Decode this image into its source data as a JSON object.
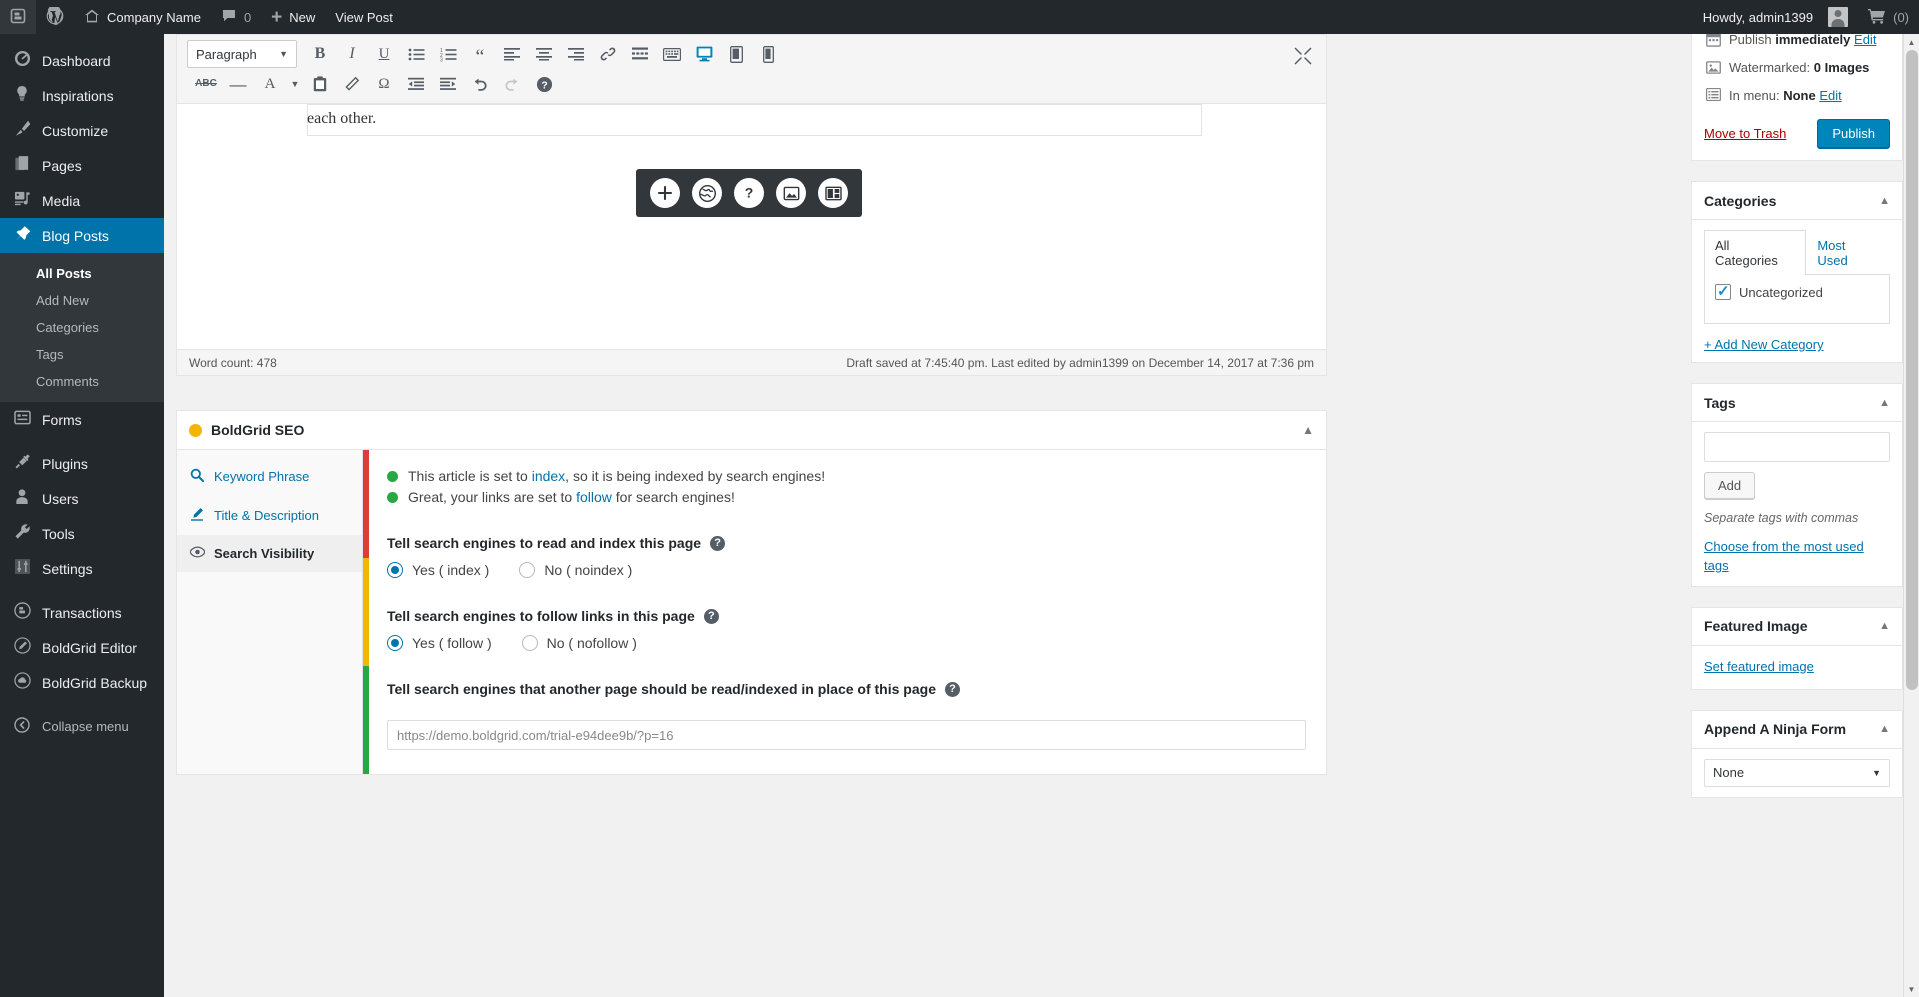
{
  "adminbar": {
    "logo_icon": "boldgrid-logo-icon",
    "wp_icon": "wordpress-icon",
    "home_icon": "home-icon",
    "site_name": "Company Name",
    "comments_icon": "comment-bubble-icon",
    "comments_count": "0",
    "new_icon": "plus-icon",
    "new_label": "New",
    "view_post_label": "View Post",
    "howdy": "Howdy, admin1399",
    "cart_icon": "cart-icon",
    "cart_count": "(0)"
  },
  "sidebar": {
    "items": [
      {
        "label": "Dashboard",
        "icon": "dashboard-gauge-icon",
        "current": false
      },
      {
        "label": "Inspirations",
        "icon": "lightbulb-icon",
        "current": false
      },
      {
        "label": "Customize",
        "icon": "paintbrush-icon",
        "current": false
      },
      {
        "label": "Pages",
        "icon": "pages-icon",
        "current": false
      },
      {
        "label": "Media",
        "icon": "media-icon",
        "current": false
      },
      {
        "label": "Blog Posts",
        "icon": "pushpin-icon",
        "current": true
      }
    ],
    "submenu": [
      {
        "label": "All Posts",
        "current": true
      },
      {
        "label": "Add New",
        "current": false
      },
      {
        "label": "Categories",
        "current": false
      },
      {
        "label": "Tags",
        "current": false
      },
      {
        "label": "Comments",
        "current": false
      }
    ],
    "items2": [
      {
        "label": "Forms",
        "icon": "forms-icon"
      }
    ],
    "items3": [
      {
        "label": "Plugins",
        "icon": "plug-icon"
      },
      {
        "label": "Users",
        "icon": "user-icon"
      },
      {
        "label": "Tools",
        "icon": "wrench-icon"
      },
      {
        "label": "Settings",
        "icon": "sliders-icon"
      }
    ],
    "items4": [
      {
        "label": "Transactions",
        "icon": "transactions-icon"
      },
      {
        "label": "BoldGrid Editor",
        "icon": "boldgrid-edit-icon"
      },
      {
        "label": "BoldGrid Backup",
        "icon": "boldgrid-cloud-icon"
      }
    ],
    "collapse": {
      "label": "Collapse menu",
      "icon": "collapse-arrow-icon"
    }
  },
  "editor": {
    "format_select": "Paragraph",
    "toolbar_row1": [
      {
        "icon": "bold-icon",
        "glyph": "B",
        "name": "bold-button"
      },
      {
        "icon": "italic-icon",
        "glyph": "I",
        "name": "italic-button"
      },
      {
        "icon": "underline-icon",
        "glyph": "U",
        "name": "underline-button"
      },
      {
        "icon": "bullet-list-icon",
        "glyph": "",
        "name": "bullet-list-button"
      },
      {
        "icon": "numbered-list-icon",
        "glyph": "",
        "name": "numbered-list-button"
      },
      {
        "icon": "blockquote-icon",
        "glyph": "“",
        "name": "blockquote-button"
      },
      {
        "icon": "align-left-icon",
        "glyph": "",
        "name": "align-left-button"
      },
      {
        "icon": "align-center-icon",
        "glyph": "",
        "name": "align-center-button"
      },
      {
        "icon": "align-right-icon",
        "glyph": "",
        "name": "align-right-button"
      },
      {
        "icon": "link-icon",
        "glyph": "",
        "name": "insert-link-button"
      },
      {
        "icon": "read-more-icon",
        "glyph": "",
        "name": "read-more-button"
      },
      {
        "icon": "keyboard-icon",
        "glyph": "",
        "name": "keyboard-shortcuts-button"
      },
      {
        "icon": "desktop-preview-icon",
        "glyph": "",
        "name": "desktop-preview-button"
      },
      {
        "icon": "tablet-preview-icon",
        "glyph": "",
        "name": "tablet-preview-button"
      },
      {
        "icon": "mobile-preview-icon",
        "glyph": "",
        "name": "mobile-preview-button"
      }
    ],
    "toolbar_row2": [
      {
        "icon": "strikethrough-icon",
        "glyph": "ABC",
        "name": "strikethrough-button"
      },
      {
        "icon": "horizontal-rule-icon",
        "glyph": "—",
        "name": "horizontal-rule-button"
      },
      {
        "icon": "text-color-icon",
        "glyph": "A",
        "name": "text-color-button"
      },
      {
        "icon": "chevron-down-icon",
        "glyph": "▾",
        "name": "text-color-dropdown"
      },
      {
        "icon": "paste-as-text-icon",
        "glyph": "",
        "name": "paste-as-text-button"
      },
      {
        "icon": "clear-formatting-icon",
        "glyph": "",
        "name": "clear-formatting-button"
      },
      {
        "icon": "special-character-icon",
        "glyph": "Ω",
        "name": "special-character-button"
      },
      {
        "icon": "outdent-icon",
        "glyph": "",
        "name": "outdent-button"
      },
      {
        "icon": "indent-icon",
        "glyph": "",
        "name": "indent-button"
      },
      {
        "icon": "undo-icon",
        "glyph": "↶",
        "name": "undo-button"
      },
      {
        "icon": "redo-icon",
        "glyph": "↷",
        "name": "redo-button"
      },
      {
        "icon": "help-icon",
        "glyph": "?",
        "name": "editor-help-button"
      }
    ],
    "fullscreen_icon": "fullscreen-icon",
    "content_text": "each other.",
    "float_toolbar": [
      {
        "icon": "plus-icon",
        "name": "add-block-button"
      },
      {
        "icon": "globe-icon",
        "name": "color-palette-button"
      },
      {
        "icon": "question-icon",
        "name": "help-button"
      },
      {
        "icon": "image-icon",
        "name": "background-image-button"
      },
      {
        "icon": "layout-icon",
        "name": "layout-button"
      }
    ],
    "word_count": "Word count: 478",
    "draft_status": "Draft saved at 7:45:40 pm. Last edited by admin1399 on December 14, 2017 at 7:36 pm"
  },
  "seo": {
    "title": "BoldGrid SEO",
    "status_color": "#f2b705",
    "collapse_icon": "chevron-up-icon",
    "tabs": [
      {
        "label": "Keyword Phrase",
        "icon": "search-icon",
        "active": false
      },
      {
        "label": "Title & Description",
        "icon": "pencil-icon",
        "active": false
      },
      {
        "label": "Search Visibility",
        "icon": "eye-icon",
        "active": true
      }
    ],
    "bar_colors": [
      "#dd3d36",
      "#f2b705",
      "#27a844"
    ],
    "messages": [
      {
        "pre": "This article is set to ",
        "link": "index",
        "post": ", so it is being indexed by search engines!"
      },
      {
        "pre": "Great, your links are set to ",
        "link": "follow",
        "post": " for search engines!"
      }
    ],
    "q_index": {
      "label": "Tell search engines to read and index this page",
      "options": [
        {
          "label": "Yes ( index )",
          "checked": true
        },
        {
          "label": "No ( noindex )",
          "checked": false
        }
      ]
    },
    "q_follow": {
      "label": "Tell search engines to follow links in this page",
      "options": [
        {
          "label": "Yes ( follow )",
          "checked": true
        },
        {
          "label": "No ( nofollow )",
          "checked": false
        }
      ]
    },
    "q_canonical": {
      "label": "Tell search engines that another page should be read/indexed in place of this page",
      "value": "https://demo.boldgrid.com/trial-e94dee9b/?p=16"
    }
  },
  "publish": {
    "rows": [
      {
        "icon": "calendar-icon",
        "prefix": "Publish ",
        "bold": "immediately",
        "link": "Edit"
      },
      {
        "icon": "image-icon",
        "prefix": "Watermarked: ",
        "bold": "0 Images",
        "link": ""
      },
      {
        "icon": "menu-icon",
        "prefix": "In menu: ",
        "bold": "None",
        "link": "Edit"
      }
    ],
    "trash_label": "Move to Trash",
    "publish_label": "Publish"
  },
  "categories": {
    "title": "Categories",
    "collapse_icon": "chevron-up-icon",
    "tabs": [
      {
        "label": "All Categories",
        "active": true
      },
      {
        "label": "Most Used",
        "active": false
      }
    ],
    "items": [
      {
        "label": "Uncategorized",
        "checked": true
      }
    ],
    "add_link": "+ Add New Category"
  },
  "tags": {
    "title": "Tags",
    "collapse_icon": "chevron-up-icon",
    "input_value": "",
    "input_placeholder": "",
    "add_label": "Add",
    "hint": "Separate tags with commas",
    "choose_link": "Choose from the most used tags"
  },
  "featured_image": {
    "title": "Featured Image",
    "collapse_icon": "chevron-up-icon",
    "set_link": "Set featured image"
  },
  "ninja_form": {
    "title": "Append A Ninja Form",
    "collapse_icon": "chevron-up-icon",
    "selected": "None",
    "dropdown_icon": "chevron-down-icon"
  },
  "scrollbar": {
    "up_icon": "scroll-up-arrow-icon",
    "down_icon": "scroll-down-arrow-icon"
  }
}
